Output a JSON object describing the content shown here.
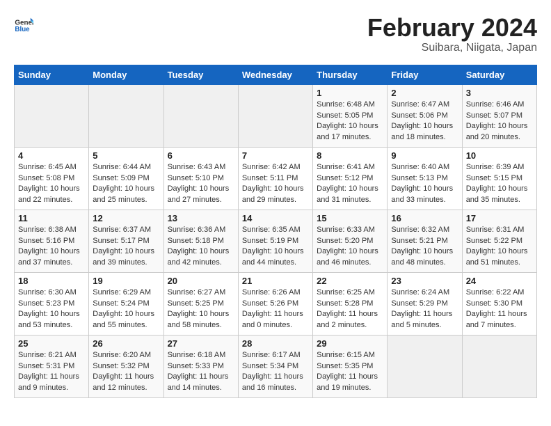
{
  "header": {
    "logo_general": "General",
    "logo_blue": "Blue",
    "main_title": "February 2024",
    "subtitle": "Suibara, Niigata, Japan"
  },
  "days_of_week": [
    "Sunday",
    "Monday",
    "Tuesday",
    "Wednesday",
    "Thursday",
    "Friday",
    "Saturday"
  ],
  "weeks": [
    [
      {
        "day": "",
        "info": ""
      },
      {
        "day": "",
        "info": ""
      },
      {
        "day": "",
        "info": ""
      },
      {
        "day": "",
        "info": ""
      },
      {
        "day": "1",
        "info": "Sunrise: 6:48 AM\nSunset: 5:05 PM\nDaylight: 10 hours and 17 minutes."
      },
      {
        "day": "2",
        "info": "Sunrise: 6:47 AM\nSunset: 5:06 PM\nDaylight: 10 hours and 18 minutes."
      },
      {
        "day": "3",
        "info": "Sunrise: 6:46 AM\nSunset: 5:07 PM\nDaylight: 10 hours and 20 minutes."
      }
    ],
    [
      {
        "day": "4",
        "info": "Sunrise: 6:45 AM\nSunset: 5:08 PM\nDaylight: 10 hours and 22 minutes."
      },
      {
        "day": "5",
        "info": "Sunrise: 6:44 AM\nSunset: 5:09 PM\nDaylight: 10 hours and 25 minutes."
      },
      {
        "day": "6",
        "info": "Sunrise: 6:43 AM\nSunset: 5:10 PM\nDaylight: 10 hours and 27 minutes."
      },
      {
        "day": "7",
        "info": "Sunrise: 6:42 AM\nSunset: 5:11 PM\nDaylight: 10 hours and 29 minutes."
      },
      {
        "day": "8",
        "info": "Sunrise: 6:41 AM\nSunset: 5:12 PM\nDaylight: 10 hours and 31 minutes."
      },
      {
        "day": "9",
        "info": "Sunrise: 6:40 AM\nSunset: 5:13 PM\nDaylight: 10 hours and 33 minutes."
      },
      {
        "day": "10",
        "info": "Sunrise: 6:39 AM\nSunset: 5:15 PM\nDaylight: 10 hours and 35 minutes."
      }
    ],
    [
      {
        "day": "11",
        "info": "Sunrise: 6:38 AM\nSunset: 5:16 PM\nDaylight: 10 hours and 37 minutes."
      },
      {
        "day": "12",
        "info": "Sunrise: 6:37 AM\nSunset: 5:17 PM\nDaylight: 10 hours and 39 minutes."
      },
      {
        "day": "13",
        "info": "Sunrise: 6:36 AM\nSunset: 5:18 PM\nDaylight: 10 hours and 42 minutes."
      },
      {
        "day": "14",
        "info": "Sunrise: 6:35 AM\nSunset: 5:19 PM\nDaylight: 10 hours and 44 minutes."
      },
      {
        "day": "15",
        "info": "Sunrise: 6:33 AM\nSunset: 5:20 PM\nDaylight: 10 hours and 46 minutes."
      },
      {
        "day": "16",
        "info": "Sunrise: 6:32 AM\nSunset: 5:21 PM\nDaylight: 10 hours and 48 minutes."
      },
      {
        "day": "17",
        "info": "Sunrise: 6:31 AM\nSunset: 5:22 PM\nDaylight: 10 hours and 51 minutes."
      }
    ],
    [
      {
        "day": "18",
        "info": "Sunrise: 6:30 AM\nSunset: 5:23 PM\nDaylight: 10 hours and 53 minutes."
      },
      {
        "day": "19",
        "info": "Sunrise: 6:29 AM\nSunset: 5:24 PM\nDaylight: 10 hours and 55 minutes."
      },
      {
        "day": "20",
        "info": "Sunrise: 6:27 AM\nSunset: 5:25 PM\nDaylight: 10 hours and 58 minutes."
      },
      {
        "day": "21",
        "info": "Sunrise: 6:26 AM\nSunset: 5:26 PM\nDaylight: 11 hours and 0 minutes."
      },
      {
        "day": "22",
        "info": "Sunrise: 6:25 AM\nSunset: 5:28 PM\nDaylight: 11 hours and 2 minutes."
      },
      {
        "day": "23",
        "info": "Sunrise: 6:24 AM\nSunset: 5:29 PM\nDaylight: 11 hours and 5 minutes."
      },
      {
        "day": "24",
        "info": "Sunrise: 6:22 AM\nSunset: 5:30 PM\nDaylight: 11 hours and 7 minutes."
      }
    ],
    [
      {
        "day": "25",
        "info": "Sunrise: 6:21 AM\nSunset: 5:31 PM\nDaylight: 11 hours and 9 minutes."
      },
      {
        "day": "26",
        "info": "Sunrise: 6:20 AM\nSunset: 5:32 PM\nDaylight: 11 hours and 12 minutes."
      },
      {
        "day": "27",
        "info": "Sunrise: 6:18 AM\nSunset: 5:33 PM\nDaylight: 11 hours and 14 minutes."
      },
      {
        "day": "28",
        "info": "Sunrise: 6:17 AM\nSunset: 5:34 PM\nDaylight: 11 hours and 16 minutes."
      },
      {
        "day": "29",
        "info": "Sunrise: 6:15 AM\nSunset: 5:35 PM\nDaylight: 11 hours and 19 minutes."
      },
      {
        "day": "",
        "info": ""
      },
      {
        "day": "",
        "info": ""
      }
    ]
  ]
}
